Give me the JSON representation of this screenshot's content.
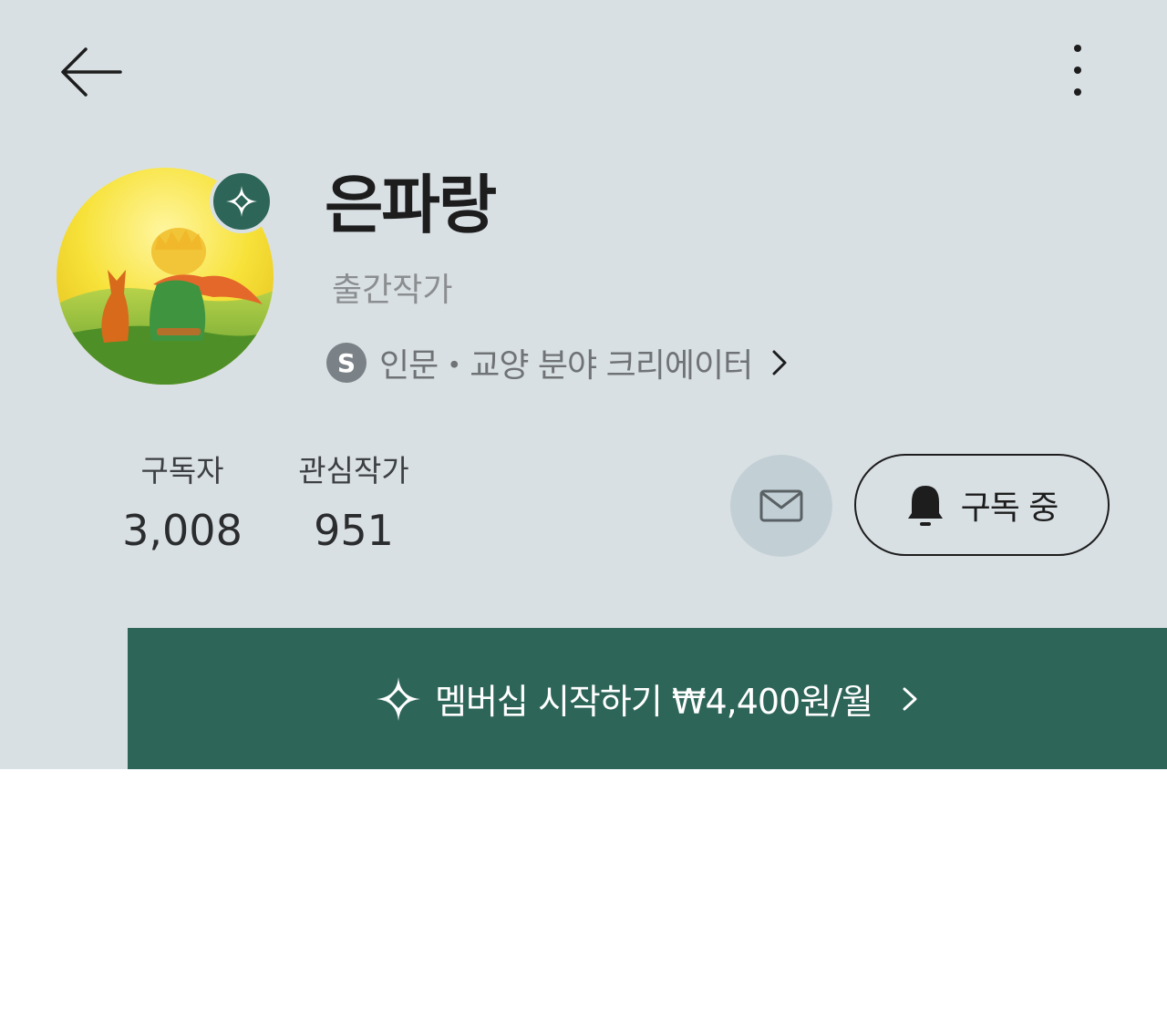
{
  "profile": {
    "name": "은파랑",
    "role": "출간작가",
    "creator_badge_letter": "S",
    "creator_category": "인문・교양 분야 크리에이터"
  },
  "stats": {
    "subscribers_label": "구독자",
    "subscribers_value": "3,008",
    "following_label": "관심작가",
    "following_value": "951"
  },
  "actions": {
    "subscribe_label": "구독 중"
  },
  "membership": {
    "label": "멤버십 시작하기 ₩4,400원/월"
  },
  "colors": {
    "header_bg": "#d9e0e4",
    "accent_green": "#2d6558",
    "mail_button_bg": "#c2d0d6"
  },
  "icons": [
    "back-arrow-icon",
    "more-vertical-icon",
    "membership-diamond-icon",
    "mail-icon",
    "bell-icon",
    "chevron-right-icon"
  ]
}
